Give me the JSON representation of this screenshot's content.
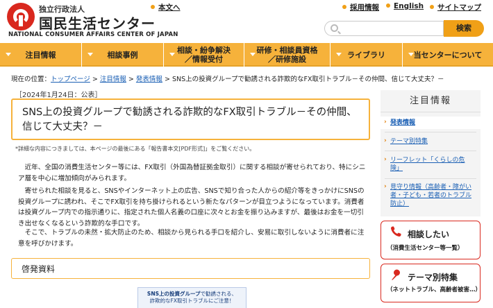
{
  "header": {
    "org_type": "独立行政法人",
    "org_name": "国民生活センター",
    "org_name_en": "NATIONAL CONSUMER AFFAIRS CENTER OF JAPAN",
    "skip_link": "本文へ",
    "utility_links": [
      "採用情報",
      "English",
      "サイトマップ"
    ],
    "search": {
      "placeholder": "",
      "button_label": "検索"
    }
  },
  "nav": {
    "items": [
      "注目情報",
      "相談事例",
      "相談・紛争解決\n／情報受付",
      "研修・相談員資格\n／研修施設",
      "ライブラリ",
      "当センターについて"
    ]
  },
  "breadcrumb": {
    "prefix": "現在の位置：",
    "links": [
      "トップページ",
      "注目情報",
      "発表情報"
    ],
    "current": "SNS上の投資グループで勧誘される詐欺的なFX取引トラブル－その仲間、信じて大丈夫？－",
    "separator": ">"
  },
  "main": {
    "date": "［2024年1月24日：公表］",
    "title": "SNS上の投資グループで勧誘される詐欺的なFX取引トラブル－その仲間、信じて大丈夫？－",
    "note": "*詳細な内容につきましては、本ページの最後にある「報告書本文[PDF形式]」をご覧ください。",
    "paragraphs": [
      "近年、全国の消費生活センター等には、FX取引（外国為替証拠金取引）に関する相談が寄せられており、特にシニア層を中心に増加傾向がみられます。",
      "寄せられた相談を見ると、SNSやインターネット上の広告、SNSで知り合った人からの紹介等をきっかけにSNSの投資グループに誘われ、そこでFX取引を持ち掛けられるという新たなパターンが目立つようになっています。消費者は投資グループ内での指示通りに、指定された個人名義の口座に次々とお金を振り込みますが、最後はお金を一切引き出せなくなるという詐欺的な手口です。",
      "そこで、トラブルの未然・拡大防止のため、相談から見られる手口を紹介し、安易に取引しないように消費者に注意を呼びかけます。"
    ],
    "section_title": "啓発資料",
    "thumbnail": {
      "line1_bold": "SNS上の投資グループ",
      "line1_rest": "で勧誘される、",
      "line2": "詐欺的なFX取引トラブルにご注意！"
    }
  },
  "sidebar": {
    "heading": "注目情報",
    "items": [
      {
        "label": "発表情報",
        "active": true
      },
      {
        "label": "テーマ別特集",
        "active": false
      },
      {
        "label": "リーフレット「くらしの危険」",
        "active": false
      },
      {
        "label": "見守り情報（高齢者・障がい者・子ども・若者のトラブル防止）",
        "active": false
      }
    ],
    "banners": [
      {
        "title": "相談したい",
        "sub": "（消費生活センター等一覧）",
        "icon": "phone-icon"
      },
      {
        "title": "テーマ別特集",
        "sub": "（ネットトラブル、高齢者被害…）",
        "icon": "pin-icon"
      }
    ]
  },
  "colors": {
    "accent": "#f6b23b",
    "brand_red": "#d9281e",
    "link": "#1a5fb4"
  }
}
